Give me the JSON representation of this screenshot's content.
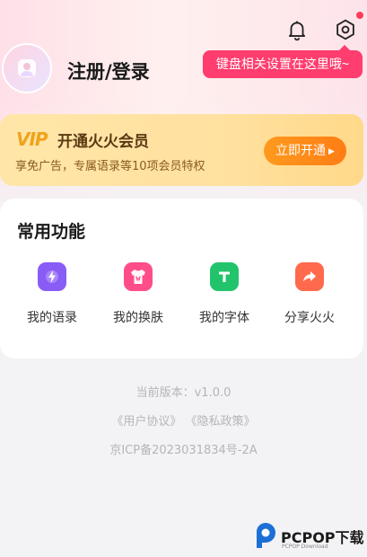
{
  "header": {
    "bell_icon": "bell-icon",
    "settings_icon": "settings-icon",
    "has_notification_dot": true,
    "tooltip": "键盘相关设置在这里哦~"
  },
  "profile": {
    "login_label": "注册/登录",
    "avatar_icon": "avatar-placeholder-icon"
  },
  "vip": {
    "badge": "VIP",
    "title": "开通火火会员",
    "subtitle": "享免广告，专属语录等10项会员特权",
    "button_label": "立即开通"
  },
  "functions": {
    "title": "常用功能",
    "items": [
      {
        "label": "我的语录",
        "icon": "lightning-icon",
        "color": "#8a5cf6"
      },
      {
        "label": "我的换肤",
        "icon": "shirt-icon",
        "color": "#ff4d8a"
      },
      {
        "label": "我的字体",
        "icon": "font-t-icon",
        "color": "#2ecc71"
      },
      {
        "label": "分享火火",
        "icon": "share-arrow-icon",
        "color": "#ff6a4d"
      }
    ]
  },
  "footer": {
    "version": "当前版本：v1.0.0",
    "agreements": "《用户协议》 《隐私政策》",
    "icp": "京ICP备2023031834号-2A"
  },
  "watermark": {
    "name": "PCPOP下载",
    "sub": "PCPOP Download"
  },
  "colors": {
    "accent": "#ff3d6e",
    "vip_button": "#ff8a1a"
  }
}
